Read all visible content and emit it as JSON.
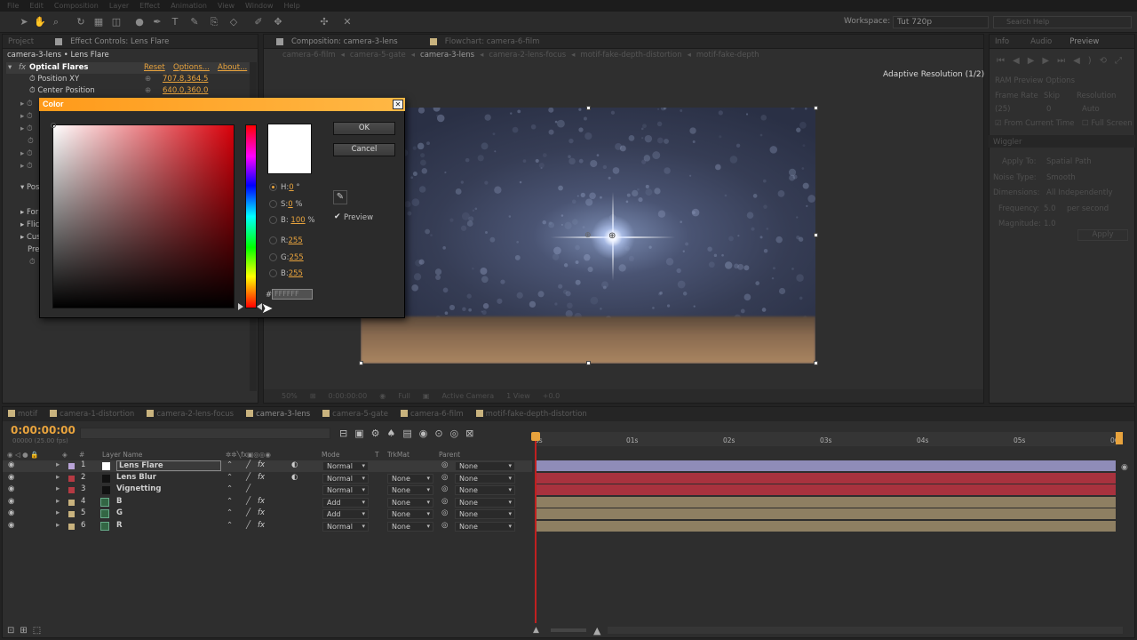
{
  "menubar": [
    "File",
    "Edit",
    "Composition",
    "Layer",
    "Effect",
    "Animation",
    "View",
    "Window",
    "Help"
  ],
  "header": {
    "workspace_label": "Workspace:",
    "workspace_value": "Tut 720p",
    "search_placeholder": "Search Help"
  },
  "effect_controls": {
    "tabs": [
      "Project",
      "Effect Controls: Lens Flare"
    ],
    "breadcrumb": "camera-3-lens • Lens Flare",
    "effect_name": "Optical Flares",
    "reset": "Reset",
    "options": "Options...",
    "about": "About...",
    "position_xy_label": "Position XY",
    "position_xy_value": "707.8,364.5",
    "center_position_label": "Center Position",
    "center_position_value": "640.0,360.0",
    "partial_rows": [
      "Pos",
      "For",
      "Flic",
      "Cus",
      "Pre"
    ]
  },
  "composition": {
    "tabs": [
      "Composition: camera-3-lens",
      "Flowchart: camera-6-film"
    ],
    "breadcrumbs": [
      "camera-6-film",
      "camera-5-gate",
      "camera-3-lens",
      "camera-2-lens-focus",
      "motif-fake-depth-distortion",
      "motif-fake-depth"
    ],
    "active_breadcrumb": "camera-3-lens",
    "adaptive_resolution": "Adaptive Resolution (1/2)",
    "footer": {
      "zoom": "50%",
      "timecode": "0:00:00:00",
      "resolution": "Full",
      "camera": "Active Camera",
      "views": "1 View",
      "exposure": "+0.0"
    }
  },
  "right_panel": {
    "tabs": [
      "Info",
      "Audio",
      "Preview"
    ],
    "ram_preview": "RAM Preview Options",
    "frame_rate_label": "Frame Rate",
    "skip_label": "Skip",
    "resolution_label": "Resolution",
    "frame_rate_value": "(25)",
    "skip_value": "0",
    "resolution_value": "Auto",
    "from_current_time": "From Current Time",
    "full_screen": "Full Screen",
    "wiggler_tab": "Wiggler",
    "apply_to_label": "Apply To:",
    "apply_to_value": "Spatial Path",
    "noise_type_label": "Noise Type:",
    "noise_type_value": "Smooth",
    "dimensions_label": "Dimensions:",
    "dimensions_value": "All Independently",
    "frequency_label": "Frequency:",
    "frequency_value": "5.0",
    "frequency_unit": "per second",
    "magnitude_label": "Magnitude:",
    "magnitude_value": "1.0",
    "apply_button": "Apply"
  },
  "timeline": {
    "tabs": [
      "motif",
      "camera-1-distortion",
      "camera-2-lens-focus",
      "camera-3-lens",
      "camera-5-gate",
      "camera-6-film",
      "motif-fake-depth-distortion"
    ],
    "active_tab": "camera-3-lens",
    "timecode": "0:00:00:00",
    "fps": "00000 (25.00 fps)",
    "columns": {
      "hash": "#",
      "layer_name": "Layer Name",
      "mode": "Mode",
      "t": "T",
      "trkmat": "TrkMat",
      "parent": "Parent"
    },
    "ruler_ticks": [
      "0s",
      "01s",
      "02s",
      "03s",
      "04s",
      "05s",
      "06s"
    ],
    "layers": [
      {
        "num": "1",
        "name": "Lens Flare",
        "mode": "Normal",
        "trkmat": "",
        "parent": "None",
        "label_color": "#b9a4d8",
        "bar_color": "#8f8cb8"
      },
      {
        "num": "2",
        "name": "Lens Blur",
        "mode": "Normal",
        "trkmat": "None",
        "parent": "None",
        "label_color": "#b53a43",
        "bar_color": "#a8323e"
      },
      {
        "num": "3",
        "name": "Vignetting",
        "mode": "Normal",
        "trkmat": "None",
        "parent": "None",
        "label_color": "#b53a43",
        "bar_color": "#a8323e"
      },
      {
        "num": "4",
        "name": "B",
        "mode": "Add",
        "trkmat": "None",
        "parent": "None",
        "label_color": "#c9b37e",
        "bar_color": "#8e7f62"
      },
      {
        "num": "5",
        "name": "G",
        "mode": "Add",
        "trkmat": "None",
        "parent": "None",
        "label_color": "#c9b37e",
        "bar_color": "#8e7f62"
      },
      {
        "num": "6",
        "name": "R",
        "mode": "Normal",
        "trkmat": "None",
        "parent": "None",
        "label_color": "#c9b37e",
        "bar_color": "#8e7f62"
      }
    ]
  },
  "color_dialog": {
    "title": "Color",
    "ok": "OK",
    "cancel": "Cancel",
    "h_label": "H:",
    "h_value": "0",
    "h_unit": "°",
    "s_label": "S:",
    "s_value": "0",
    "s_unit": "%",
    "b_label": "B:",
    "b_value": "100",
    "b_unit": "%",
    "r_label": "R:",
    "r_value": "255",
    "g_label": "G:",
    "g_value": "255",
    "b2_label": "B:",
    "b2_value": "255",
    "hash": "#",
    "hex_value": "FFFFFF",
    "preview_label": "Preview",
    "preview_checked": true,
    "selected_color": "#ffffff",
    "hue_color": "#d8000a"
  },
  "colors": {
    "accent": "#e8a33d",
    "title_bar": "#ffa526"
  }
}
